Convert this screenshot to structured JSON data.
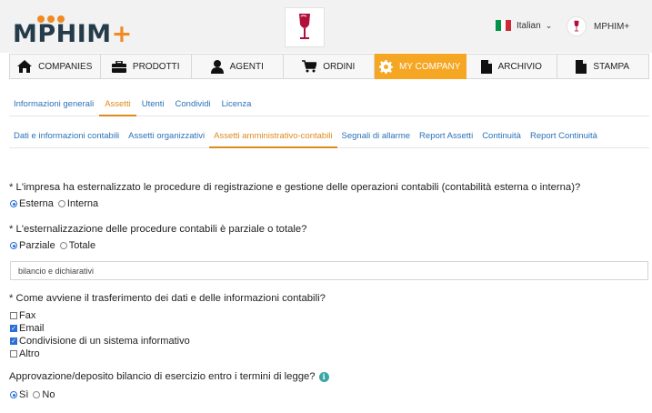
{
  "header": {
    "logo_text": "MPHIM",
    "logo_plus": "+",
    "language": "Italian",
    "user_name": "MPHIM+"
  },
  "nav": [
    {
      "label": "COMPANIES",
      "icon": "home-icon"
    },
    {
      "label": "PRODOTTI",
      "icon": "briefcase-icon"
    },
    {
      "label": "AGENTI",
      "icon": "user-icon"
    },
    {
      "label": "ORDINI",
      "icon": "cart-icon"
    },
    {
      "label": "MY COMPANY",
      "icon": "gear-icon",
      "active": true
    },
    {
      "label": "ARCHIVIO",
      "icon": "document-icon"
    },
    {
      "label": "STAMPA",
      "icon": "document-icon"
    }
  ],
  "tabs_main": [
    {
      "label": "Informazioni generali"
    },
    {
      "label": "Assetti",
      "active": true
    },
    {
      "label": "Utenti"
    },
    {
      "label": "Condividi"
    },
    {
      "label": "Licenza"
    }
  ],
  "tabs_sub": [
    {
      "label": "Dati e informazioni contabili"
    },
    {
      "label": "Assetti organizzativi"
    },
    {
      "label": "Assetti amministrativo-contabili",
      "active": true
    },
    {
      "label": "Segnali di allarme"
    },
    {
      "label": "Report Assetti"
    },
    {
      "label": "Continuità"
    },
    {
      "label": "Report Continuità"
    }
  ],
  "form": {
    "q1": "* L'impresa ha esternalizzato le procedure di registrazione e gestione delle operazioni contabili (contabilità esterna o interna)?",
    "q1_options": [
      "Esterna",
      "Interna"
    ],
    "q1_selected": "Esterna",
    "q2": "* L'esternalizzazione delle procedure contabili è parziale o totale?",
    "q2_options": [
      "Parziale",
      "Totale"
    ],
    "q2_selected": "Parziale",
    "q2_detail_value": "bilancio e dichiarativi",
    "q3": "* Come avviene il trasferimento dei dati e delle informazioni contabili?",
    "q3_options": [
      {
        "label": "Fax",
        "checked": false
      },
      {
        "label": "Email",
        "checked": true
      },
      {
        "label": "Condivisione di un sistema informativo",
        "checked": true
      },
      {
        "label": "Altro",
        "checked": false
      }
    ],
    "q4": "Approvazione/deposito bilancio di esercizio entro i termini di legge?",
    "q4_options": [
      "Sì",
      "No"
    ],
    "q4_selected": "Sì"
  },
  "colors": {
    "accent": "#f5a623",
    "link": "#2a72b8",
    "tab_active": "#e08a1e",
    "logo_dark": "#243b4a",
    "logo_orange": "#f08a24"
  }
}
